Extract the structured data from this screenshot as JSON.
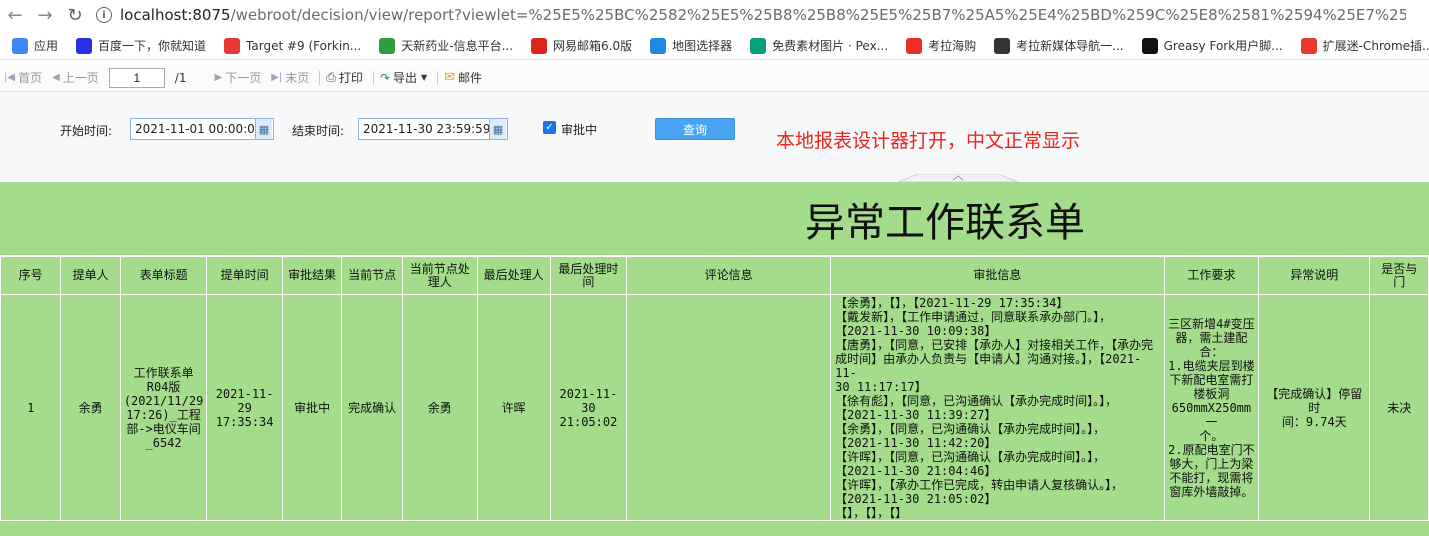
{
  "browser": {
    "url_host": "localhost:8075",
    "url_path": "/webroot/decision/view/report?viewlet=%25E5%25BC%2582%25E5%25B8%25B8%25E5%25B7%25A5%25E4%25BD%259C%25E8%2581%2594%25E7%25B3%25BB%25E5%258D%2595",
    "bookmarks": [
      {
        "label": "应用",
        "icon": "apps-grid-icon",
        "color": "#4285f4"
      },
      {
        "label": "百度一下，你就知道",
        "icon": "baidu-paw-icon",
        "color": "#2932e1"
      },
      {
        "label": "Target #9 (Forkin...",
        "icon": "target-x-icon",
        "color": "#e53935"
      },
      {
        "label": "天新药业-信息平台...",
        "icon": "tianxin-t-icon",
        "color": "#2e9e3f"
      },
      {
        "label": "网易邮箱6.0版",
        "icon": "netease-mail-icon",
        "color": "#d9261c"
      },
      {
        "label": "地图选择器",
        "icon": "map-arrow-icon",
        "color": "#1e88e5"
      },
      {
        "label": "免费素材图片 · Pex...",
        "icon": "pexels-d-icon",
        "color": "#05a081"
      },
      {
        "label": "考拉海购",
        "icon": "kaola-icon",
        "color": "#e9302e"
      },
      {
        "label": "考拉新媒体导航一...",
        "icon": "kaola-media-icon",
        "color": "#333333"
      },
      {
        "label": "Greasy Fork用户脚...",
        "icon": "greasyfork-icon",
        "color": "#111111"
      },
      {
        "label": "扩展迷-Chrome插...",
        "icon": "extfans-ex-icon",
        "color": "#e53935"
      }
    ]
  },
  "toolbar": {
    "first": "首页",
    "prev": "上一页",
    "page_value": "1",
    "page_total": "/1",
    "next": "下一页",
    "last": "末页",
    "print": "打印",
    "export": "导出",
    "mail": "邮件"
  },
  "params": {
    "start_label": "开始时间:",
    "start_value": "2021-11-01 00:00:00",
    "end_label": "结束时间:",
    "end_value": "2021-11-30 23:59:59",
    "checkbox_label": "审批中",
    "checkbox_checked": true,
    "query_button": "查询",
    "note": "本地报表设计器打开，中文正常显示"
  },
  "report": {
    "title": "异常工作联系单",
    "headers": [
      "序号",
      "提单人",
      "表单标题",
      "提单时间",
      "审批结果",
      "当前节点",
      "当前节点处理人",
      "最后处理人",
      "最后处理时间",
      "评论信息",
      "审批信息",
      "工作要求",
      "异常说明",
      "是否与\n门"
    ],
    "rows": [
      {
        "index": "1",
        "submitter": "余勇",
        "form_title": "工作联系单\nR04版\n(2021/11/29\n17:26)_工程\n部->电仪车间\n_6542",
        "submit_time": "2021-11-29\n17:35:34",
        "result": "审批中",
        "current_node": "完成确认",
        "current_handler": "余勇",
        "last_handler": "许晖",
        "last_time": "2021-11-30\n21:05:02",
        "comment": "",
        "approval": "【余勇】，【】，【2021-11-29 17:35:34】\n【戴发新】，【工作申请通过，同意联系承办部门。】，\n【2021-11-30 10:09:38】\n【唐勇】，【同意，已安排【承办人】对接相关工作，【承办完\n成时间】由承办人负责与【申请人】沟通对接。】，【2021-11-\n30 11:17:17】\n【徐有彪】，【同意，已沟通确认【承办完成时间】。】，\n【2021-11-30 11:39:27】\n【余勇】，【同意，已沟通确认【承办完成时间】。】，\n【2021-11-30 11:42:20】\n【许晖】，【同意，已沟通确认【承办完成时间】。】，\n【2021-11-30 21:04:46】\n【许晖】，【承办工作已完成，转由申请人复核确认。】，\n【2021-11-30 21:05:02】\n【】，【】，【】",
        "requirement": "三区新增4#变压\n器，需土建配\n合：\n1.电缆夹层到楼\n下新配电室需打\n楼板洞\n650mmX250mm一\n个。\n2.原配电室门不\n够大，门上为梁\n不能打，现需将\n窗库外墙敲掉。",
        "exception": "【完成确认】停留时\n间：9.74天",
        "partial": "未决"
      }
    ]
  }
}
